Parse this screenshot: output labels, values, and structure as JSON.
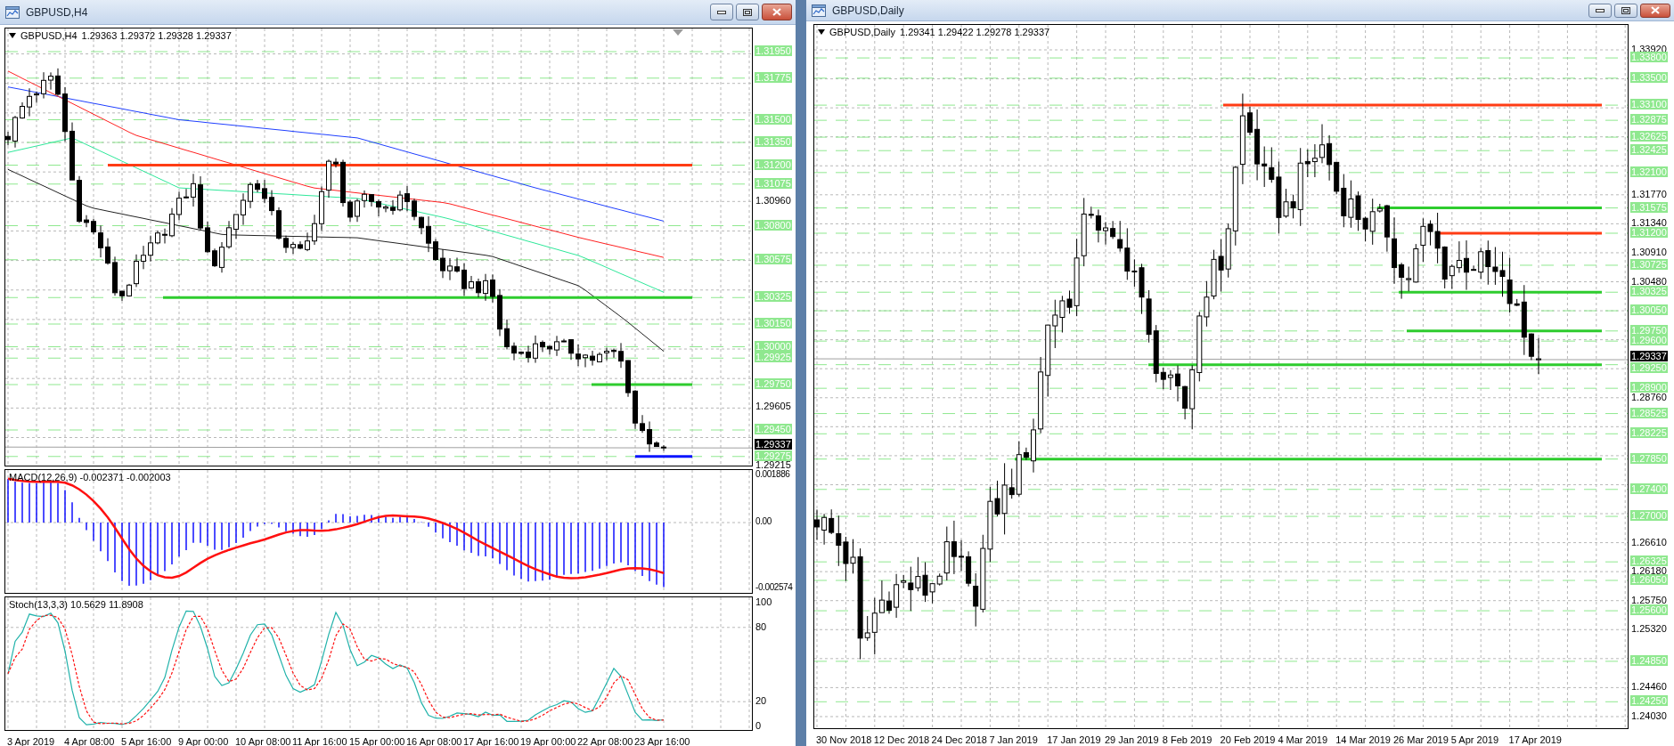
{
  "windows": [
    {
      "kind": "h4",
      "title": "GBPUSD,H4",
      "header": {
        "symbol": "GBPUSD,H4",
        "quote": "1.29363 1.29372 1.29328 1.29337"
      },
      "scale_labels": [
        "1.30960",
        "1.29605",
        "1.29215"
      ],
      "level_labels": [
        "1.31950",
        "1.31775",
        "1.31500",
        "1.31350",
        "1.31200",
        "1.31075",
        "1.30800",
        "1.30575",
        "1.30325",
        "1.30150",
        "1.30000",
        "1.29925",
        "1.29750",
        "1.29450",
        "1.29275"
      ],
      "current_price": "1.29337",
      "indicators": [
        {
          "kind": "macd",
          "label": "MACD(12,26,9) -0.002371 -0.002003",
          "scale_labels": [
            "0.001886",
            "0.00",
            "-0.002574"
          ]
        },
        {
          "kind": "stoch",
          "label": "Stoch(13,3,3) 10.5629 11.8908",
          "scale_labels": [
            "100",
            "80",
            "20",
            "0"
          ]
        }
      ],
      "time_labels": [
        "3 Apr 2019",
        "4 Apr 08:00",
        "5 Apr 16:00",
        "9 Apr 00:00",
        "10 Apr 08:00",
        "11 Apr 16:00",
        "15 Apr 00:00",
        "16 Apr 08:00",
        "17 Apr 16:00",
        "19 Apr 00:00",
        "22 Apr 08:00",
        "23 Apr 16:00"
      ]
    },
    {
      "kind": "daily",
      "title": "GBPUSD,Daily",
      "header": {
        "symbol": "GBPUSD,Daily",
        "quote": "1.29341 1.29422 1.29278 1.29337"
      },
      "scale_labels": [
        "1.33920",
        "1.31770",
        "1.31340",
        "1.30910",
        "1.30480",
        "1.28760",
        "1.26610",
        "1.26180",
        "1.25750",
        "1.25320",
        "1.24460",
        "1.24030"
      ],
      "level_labels": [
        "1.33800",
        "1.33500",
        "1.33100",
        "1.32875",
        "1.32625",
        "1.32425",
        "1.32100",
        "1.31575",
        "1.31200",
        "1.30725",
        "1.30325",
        "1.30050",
        "1.29750",
        "1.29600",
        "1.29250",
        "1.28900",
        "1.28525",
        "1.28225",
        "1.27850",
        "1.27400",
        "1.27000",
        "1.26325",
        "1.26050",
        "1.25600",
        "1.24850",
        "1.24250"
      ],
      "current_price": "1.29337",
      "time_labels": [
        "30 Nov 2018",
        "12 Dec 2018",
        "24 Dec 2018",
        "7 Jan 2019",
        "17 Jan 2019",
        "29 Jan 2019",
        "8 Feb 2019",
        "20 Feb 2019",
        "4 Mar 2019",
        "14 Mar 2019",
        "26 Mar 2019",
        "5 Apr 2019",
        "17 Apr 2019"
      ]
    }
  ]
}
